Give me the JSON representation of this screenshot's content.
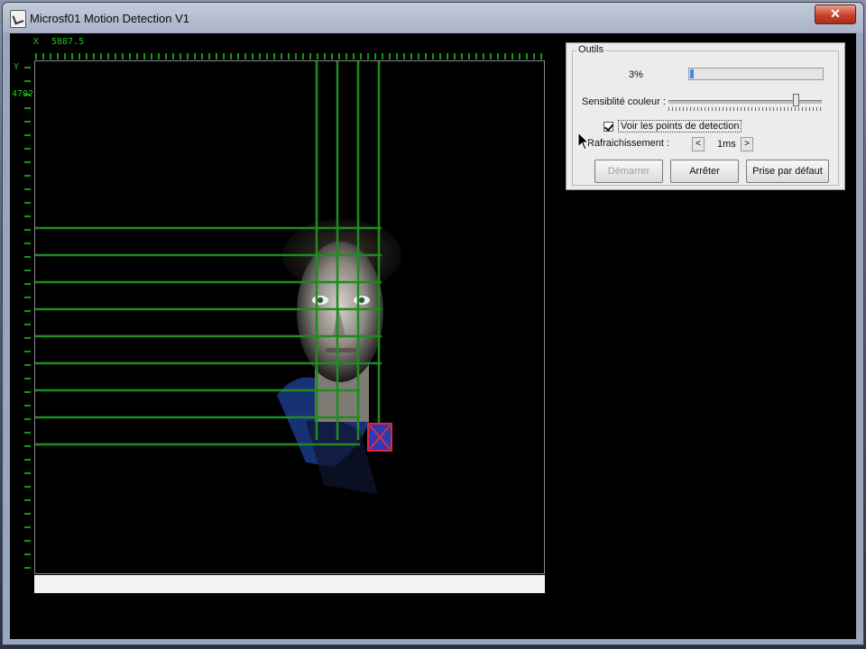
{
  "window": {
    "title": "Microsf01 Motion Detection V1",
    "close_symbol": "✕"
  },
  "axis": {
    "x_label": "X",
    "x_value": "5887.5",
    "y_label": "Y",
    "y_value": "4702"
  },
  "outils": {
    "title": "Outils",
    "progress_text": "3%",
    "progress_value": 0.03,
    "sensitivity_label": "Sensiblité couleur :",
    "sensitivity_value": 0.82,
    "show_points_label": "Voir les points de detection",
    "show_points_checked": true,
    "refresh_label": "Rafraichissement :",
    "refresh_value": "1ms",
    "spin_left": "<",
    "spin_right": ">",
    "buttons": {
      "start": "Démarrer",
      "stop": "Arrêter",
      "default": "Prise par défaut"
    }
  },
  "colors": {
    "grid": "#1e8c1e",
    "axis": "#21c421",
    "marker": "#e0283a",
    "marker_inner": "#2b3bb8"
  },
  "icons": {
    "app": "app-icon",
    "close": "close-icon",
    "cursor": "cursor-icon",
    "detection_marker": "detection-marker-icon"
  }
}
